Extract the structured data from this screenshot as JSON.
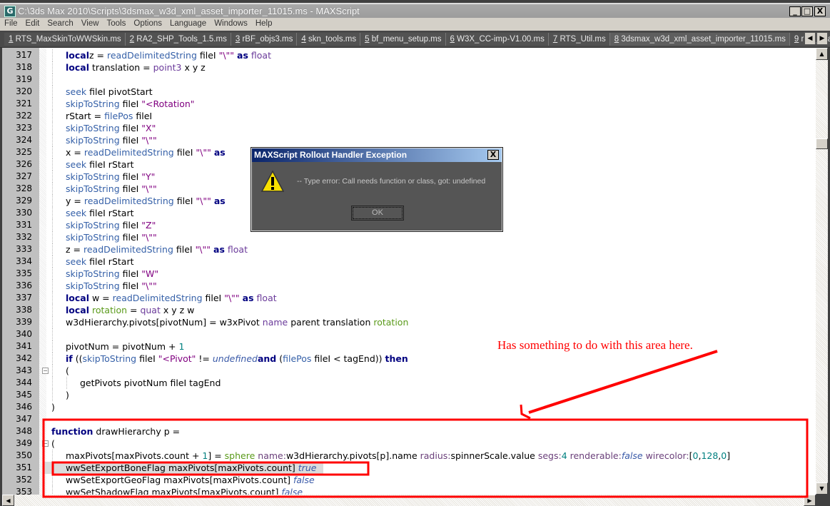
{
  "window": {
    "title": "C:\\3ds Max 2010\\Scripts\\3dsmax_w3d_xml_asset_importer_11015.ms - MAXScript",
    "app_icon": "3ds-max-icon",
    "minimize": "_",
    "maximize": "□",
    "close": "X"
  },
  "menu": [
    "File",
    "Edit",
    "Search",
    "View",
    "Tools",
    "Options",
    "Language",
    "Windows",
    "Help"
  ],
  "tabs": [
    {
      "num": "1",
      "label": "RTS_MaxSkinToWWSkin.ms"
    },
    {
      "num": "2",
      "label": "RA2_SHP_Tools_1.5.ms"
    },
    {
      "num": "3",
      "label": "rBF_objs3.ms"
    },
    {
      "num": "4",
      "label": "skn_tools.ms"
    },
    {
      "num": "5",
      "label": "bf_menu_setup.ms"
    },
    {
      "num": "6",
      "label": "W3X_CC-imp-V1.00.ms"
    },
    {
      "num": "7",
      "label": "RTS_Util.ms"
    },
    {
      "num": "8",
      "label": "3dsmax_w3d_xml_asset_importer_11015.ms"
    },
    {
      "num": "9",
      "label": "rBF_wrappers.ms"
    }
  ],
  "active_tab": "8",
  "code_lines": [
    {
      "n": "317",
      "indent": 2,
      "tokens": [
        [
          "k",
          "local"
        ],
        [
          "",
          "z = "
        ],
        [
          "f",
          "readDelimitedString"
        ],
        [
          "",
          " fileI "
        ],
        [
          "s",
          "\"\\\"\""
        ],
        [
          "",
          " "
        ],
        [
          "k",
          "as"
        ],
        [
          "",
          " "
        ],
        [
          "t",
          "float"
        ]
      ]
    },
    {
      "n": "318",
      "indent": 2,
      "tokens": [
        [
          "k",
          "local"
        ],
        [
          "",
          " translation = "
        ],
        [
          "t",
          "point3"
        ],
        [
          "",
          " x y z"
        ]
      ]
    },
    {
      "n": "319",
      "indent": 2,
      "tokens": []
    },
    {
      "n": "320",
      "indent": 2,
      "tokens": [
        [
          "f",
          "seek"
        ],
        [
          "",
          " fileI pivotStart"
        ]
      ]
    },
    {
      "n": "321",
      "indent": 2,
      "tokens": [
        [
          "f",
          "skipToString"
        ],
        [
          "",
          " fileI "
        ],
        [
          "s",
          "\"<Rotation\""
        ]
      ]
    },
    {
      "n": "322",
      "indent": 2,
      "tokens": [
        [
          "",
          "rStart = "
        ],
        [
          "f",
          "filePos"
        ],
        [
          "",
          " fileI"
        ]
      ]
    },
    {
      "n": "323",
      "indent": 2,
      "tokens": [
        [
          "f",
          "skipToString"
        ],
        [
          "",
          " fileI "
        ],
        [
          "s",
          "\"X\""
        ]
      ]
    },
    {
      "n": "324",
      "indent": 2,
      "tokens": [
        [
          "f",
          "skipToString"
        ],
        [
          "",
          " fileI "
        ],
        [
          "s",
          "\"\\\"\""
        ]
      ]
    },
    {
      "n": "325",
      "indent": 2,
      "tokens": [
        [
          "",
          "x = "
        ],
        [
          "f",
          "readDelimitedString"
        ],
        [
          "",
          " fileI "
        ],
        [
          "s",
          "\"\\\"\""
        ],
        [
          "",
          " "
        ],
        [
          "k",
          "as"
        ]
      ]
    },
    {
      "n": "326",
      "indent": 2,
      "tokens": [
        [
          "f",
          "seek"
        ],
        [
          "",
          " fileI rStart"
        ]
      ]
    },
    {
      "n": "327",
      "indent": 2,
      "tokens": [
        [
          "f",
          "skipToString"
        ],
        [
          "",
          " fileI "
        ],
        [
          "s",
          "\"Y\""
        ]
      ]
    },
    {
      "n": "328",
      "indent": 2,
      "tokens": [
        [
          "f",
          "skipToString"
        ],
        [
          "",
          " fileI "
        ],
        [
          "s",
          "\"\\\"\""
        ]
      ]
    },
    {
      "n": "329",
      "indent": 2,
      "tokens": [
        [
          "",
          "y = "
        ],
        [
          "f",
          "readDelimitedString"
        ],
        [
          "",
          " fileI "
        ],
        [
          "s",
          "\"\\\"\""
        ],
        [
          "",
          " "
        ],
        [
          "k",
          "as"
        ]
      ]
    },
    {
      "n": "330",
      "indent": 2,
      "tokens": [
        [
          "f",
          "seek"
        ],
        [
          "",
          " fileI rStart"
        ]
      ]
    },
    {
      "n": "331",
      "indent": 2,
      "tokens": [
        [
          "f",
          "skipToString"
        ],
        [
          "",
          " fileI "
        ],
        [
          "s",
          "\"Z\""
        ]
      ]
    },
    {
      "n": "332",
      "indent": 2,
      "tokens": [
        [
          "f",
          "skipToString"
        ],
        [
          "",
          " fileI "
        ],
        [
          "s",
          "\"\\\"\""
        ]
      ]
    },
    {
      "n": "333",
      "indent": 2,
      "tokens": [
        [
          "",
          "z = "
        ],
        [
          "f",
          "readDelimitedString"
        ],
        [
          "",
          " fileI "
        ],
        [
          "s",
          "\"\\\"\""
        ],
        [
          "",
          " "
        ],
        [
          "k",
          "as"
        ],
        [
          "",
          " "
        ],
        [
          "t",
          "float"
        ]
      ]
    },
    {
      "n": "334",
      "indent": 2,
      "tokens": [
        [
          "f",
          "seek"
        ],
        [
          "",
          " fileI rStart"
        ]
      ]
    },
    {
      "n": "335",
      "indent": 2,
      "tokens": [
        [
          "f",
          "skipToString"
        ],
        [
          "",
          " fileI "
        ],
        [
          "s",
          "\"W\""
        ]
      ]
    },
    {
      "n": "336",
      "indent": 2,
      "tokens": [
        [
          "f",
          "skipToString"
        ],
        [
          "",
          " fileI "
        ],
        [
          "s",
          "\"\\\"\""
        ]
      ]
    },
    {
      "n": "337",
      "indent": 2,
      "tokens": [
        [
          "k",
          "local"
        ],
        [
          "",
          " w = "
        ],
        [
          "f",
          "readDelimitedString"
        ],
        [
          "",
          " fileI "
        ],
        [
          "s",
          "\"\\\"\""
        ],
        [
          "",
          " "
        ],
        [
          "k",
          "as"
        ],
        [
          "",
          " "
        ],
        [
          "t",
          "float"
        ]
      ]
    },
    {
      "n": "338",
      "indent": 2,
      "tokens": [
        [
          "k",
          "local"
        ],
        [
          "",
          " "
        ],
        [
          "g",
          "rotation"
        ],
        [
          "",
          " = "
        ],
        [
          "t",
          "quat"
        ],
        [
          "",
          " x y z w"
        ]
      ]
    },
    {
      "n": "339",
      "indent": 2,
      "tokens": [
        [
          "",
          "w3dHierarchy.pivots[pivotNum] = w3xPivot "
        ],
        [
          "t",
          "name"
        ],
        [
          "",
          " parent translation "
        ],
        [
          "g",
          "rotation"
        ]
      ]
    },
    {
      "n": "340",
      "indent": 2,
      "tokens": []
    },
    {
      "n": "341",
      "indent": 2,
      "tokens": [
        [
          "",
          "pivotNum = pivotNum + "
        ],
        [
          "n",
          "1"
        ]
      ]
    },
    {
      "n": "342",
      "indent": 2,
      "tokens": [
        [
          "k",
          "if"
        ],
        [
          "",
          " (("
        ],
        [
          "f",
          "skipToString"
        ],
        [
          "",
          " fileI "
        ],
        [
          "s",
          "\"<Pivot\""
        ],
        [
          "",
          " != "
        ],
        [
          "i",
          "undefined"
        ],
        [
          ") "
        ],
        [
          "k",
          "and"
        ],
        [
          "",
          " ("
        ],
        [
          "f",
          "filePos"
        ],
        [
          "",
          " fileI < tagEnd)) "
        ],
        [
          "k",
          "then"
        ]
      ]
    },
    {
      "n": "343",
      "indent": 2,
      "fold": true,
      "tokens": [
        [
          "",
          "("
        ]
      ]
    },
    {
      "n": "344",
      "indent": 3,
      "tokens": [
        [
          "",
          "getPivots pivotNum fileI tagEnd"
        ]
      ]
    },
    {
      "n": "345",
      "indent": 2,
      "tokens": [
        [
          "",
          ")"
        ]
      ]
    },
    {
      "n": "346",
      "indent": 1,
      "tokens": [
        [
          "",
          ")"
        ]
      ]
    },
    {
      "n": "347",
      "indent": 1,
      "tokens": []
    },
    {
      "n": "348",
      "indent": 1,
      "tokens": [
        [
          "k",
          "function"
        ],
        [
          "",
          " drawHierarchy p ="
        ]
      ]
    },
    {
      "n": "349",
      "indent": 1,
      "fold": true,
      "tokens": [
        [
          "",
          "("
        ]
      ]
    },
    {
      "n": "350",
      "indent": 2,
      "tokens": [
        [
          "",
          "maxPivots[maxPivots.count + "
        ],
        [
          "n",
          "1"
        ],
        [
          "",
          "] = "
        ],
        [
          "g",
          "sphere"
        ],
        [
          "",
          " "
        ],
        [
          "p",
          "name:"
        ],
        [
          "",
          "w3dHierarchy.pivots[p].name "
        ],
        [
          "p",
          "radius:"
        ],
        [
          "",
          "spinnerScale.value "
        ],
        [
          "p",
          "segs:"
        ],
        [
          "n",
          "4"
        ],
        [
          "",
          " "
        ],
        [
          "p",
          "renderable:"
        ],
        [
          "i",
          "false"
        ],
        [
          "",
          " "
        ],
        [
          "p",
          "wirecolor:"
        ],
        [
          "",
          "["
        ],
        [
          "n",
          "0"
        ],
        [
          "",
          ","
        ],
        [
          "n",
          "128"
        ],
        [
          "",
          ","
        ],
        [
          "n",
          "0"
        ],
        [
          "",
          "]"
        ]
      ]
    },
    {
      "n": "351",
      "indent": 2,
      "highlight": true,
      "tokens": [
        [
          "",
          "wwSetExportBoneFlag maxPivots[maxPivots.count] "
        ],
        [
          "i",
          "true"
        ]
      ]
    },
    {
      "n": "352",
      "indent": 2,
      "tokens": [
        [
          "",
          "wwSetExportGeoFlag maxPivots[maxPivots.count] "
        ],
        [
          "i",
          "false"
        ]
      ]
    },
    {
      "n": "353",
      "indent": 2,
      "tokens": [
        [
          "",
          "wwSetShadowFlag maxPivots[maxPivots.count] "
        ],
        [
          "i",
          "false"
        ]
      ]
    }
  ],
  "dialog": {
    "title": "MAXScript Rollout Handler Exception",
    "icon": "warning-icon",
    "message": "-- Type error: Call needs function or class, got: undefined",
    "ok_label": "OK",
    "close": "X"
  },
  "annotation": {
    "note": "Has something to do with this area here.",
    "color": "#ff0000"
  },
  "colors": {
    "keyword": "#000080",
    "function": "#3560a8",
    "string": "#800080",
    "number": "#008080"
  }
}
